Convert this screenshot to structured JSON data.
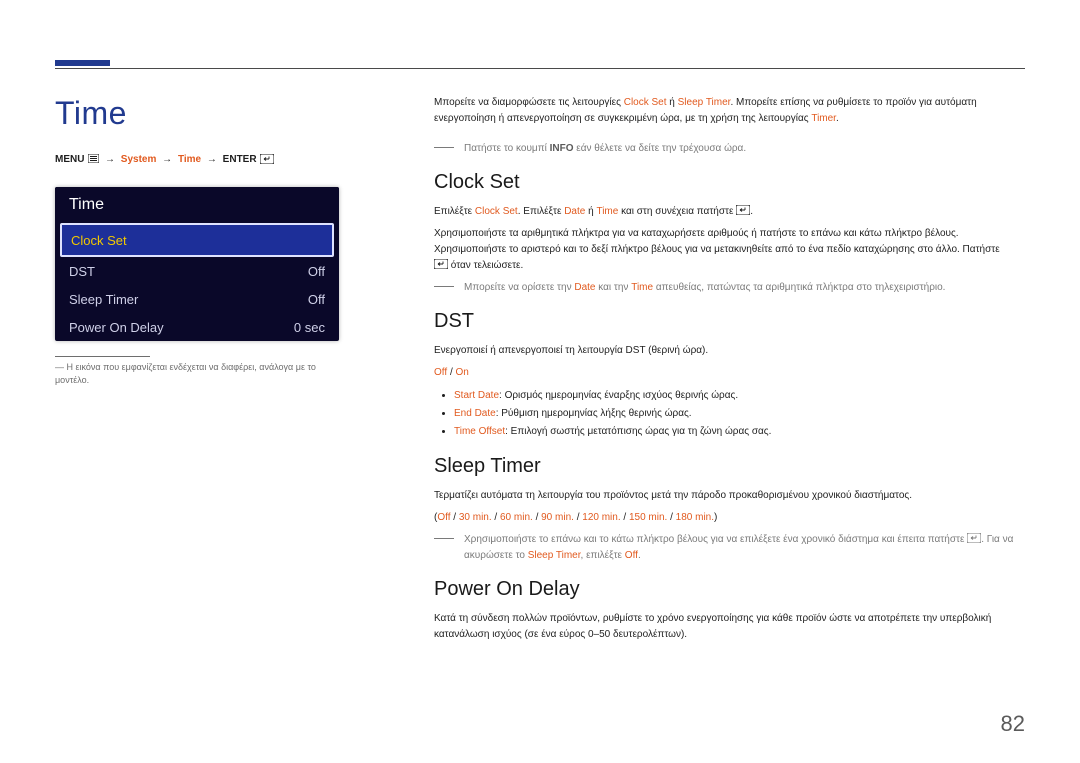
{
  "page_number": "82",
  "page_title": "Time",
  "breadcrumb": {
    "menu": "MENU",
    "system": "System",
    "time": "Time",
    "enter": "ENTER"
  },
  "panel": {
    "title": "Time",
    "rows": [
      {
        "label": "Clock Set",
        "value": ""
      },
      {
        "label": "DST",
        "value": "Off"
      },
      {
        "label": "Sleep Timer",
        "value": "Off"
      },
      {
        "label": "Power On Delay",
        "value": "0 sec"
      }
    ]
  },
  "panel_caption_prefix": "―",
  "panel_caption": "Η εικόνα που εμφανίζεται ενδέχεται να διαφέρει, ανάλογα με το μοντέλο.",
  "intro": {
    "t1": "Μπορείτε να διαμορφώσετε τις λειτουργίες ",
    "clock_set": "Clock Set",
    "or": " ή ",
    "sleep_timer": "Sleep Timer",
    "t2": ". Μπορείτε επίσης να ρυθμίσετε το προϊόν για αυτόματη ενεργοποίηση ή απενεργοποίηση σε συγκεκριμένη ώρα, με τη χρήση της λειτουργίας ",
    "timer": "Timer",
    "t3": "."
  },
  "intro_note": {
    "t1": "Πατήστε το κουμπί ",
    "info": "INFO",
    "t2": " εάν θέλετε να δείτε την τρέχουσα ώρα."
  },
  "clock_set": {
    "title": "Clock Set",
    "p1a": "Επιλέξτε ",
    "p1b": "Clock Set",
    "p1c": ". Επιλέξτε ",
    "p1d": "Date",
    "p1e": " ή ",
    "p1f": "Time",
    "p1g": " και στη συνέχεια πατήστε ",
    "p1h": ".",
    "p2": "Χρησιμοποιήστε τα αριθμητικά πλήκτρα για να καταχωρήσετε αριθμούς ή πατήστε το επάνω και κάτω πλήκτρο βέλους. Χρησιμοποιήστε το αριστερό και το δεξί πλήκτρο βέλους για να μετακινηθείτε από το ένα πεδίο καταχώρησης στο άλλο. Πατήστε ",
    "p2b": " όταν τελειώσετε.",
    "note_a": "Μπορείτε να ορίσετε την ",
    "note_date": "Date",
    "note_b": " και την ",
    "note_time": "Time",
    "note_c": " απευθείας, πατώντας τα αριθμητικά πλήκτρα στο τηλεχειριστήριο."
  },
  "dst": {
    "title": "DST",
    "p1": "Ενεργοποιεί ή απενεργοποιεί τη λειτουργία DST (θερινή ώρα).",
    "opt_off": "Off",
    "opt_on": "On",
    "b1_label": "Start Date",
    "b1_text": ": Ορισμός ημερομηνίας έναρξης ισχύος θερινής ώρας.",
    "b2_label": "End Date",
    "b2_text": ": Ρύθμιση ημερομηνίας λήξης θερινής ώρας.",
    "b3_label": "Time Offset",
    "b3_text": ": Επιλογή σωστής μετατόπισης ώρας για τη ζώνη ώρας σας."
  },
  "sleep_timer": {
    "title": "Sleep Timer",
    "p1": "Τερματίζει αυτόματα τη λειτουργία του προϊόντος μετά την πάροδο προκαθορισμένου χρονικού διαστήματος.",
    "opts": [
      "Off",
      "30 min.",
      "60 min.",
      "90 min.",
      "120 min.",
      "150 min.",
      "180 min."
    ],
    "note_a": "Χρησιμοποιήστε το επάνω και το κάτω πλήκτρο βέλους για να επιλέξετε ένα χρονικό διάστημα και έπειτα πατήστε ",
    "note_b": ". Για να ακυρώσετε το ",
    "note_sleep": "Sleep Timer",
    "note_c": ", επιλέξτε ",
    "note_off": "Off",
    "note_d": "."
  },
  "power_on_delay": {
    "title": "Power On Delay",
    "p1": "Κατά τη σύνδεση πολλών προϊόντων, ρυθμίστε το χρόνο ενεργοποίησης για κάθε προϊόν ώστε να αποτρέπετε την υπερβολική κατανάλωση ισχύος (σε ένα εύρος 0–50 δευτερολέπτων)."
  }
}
